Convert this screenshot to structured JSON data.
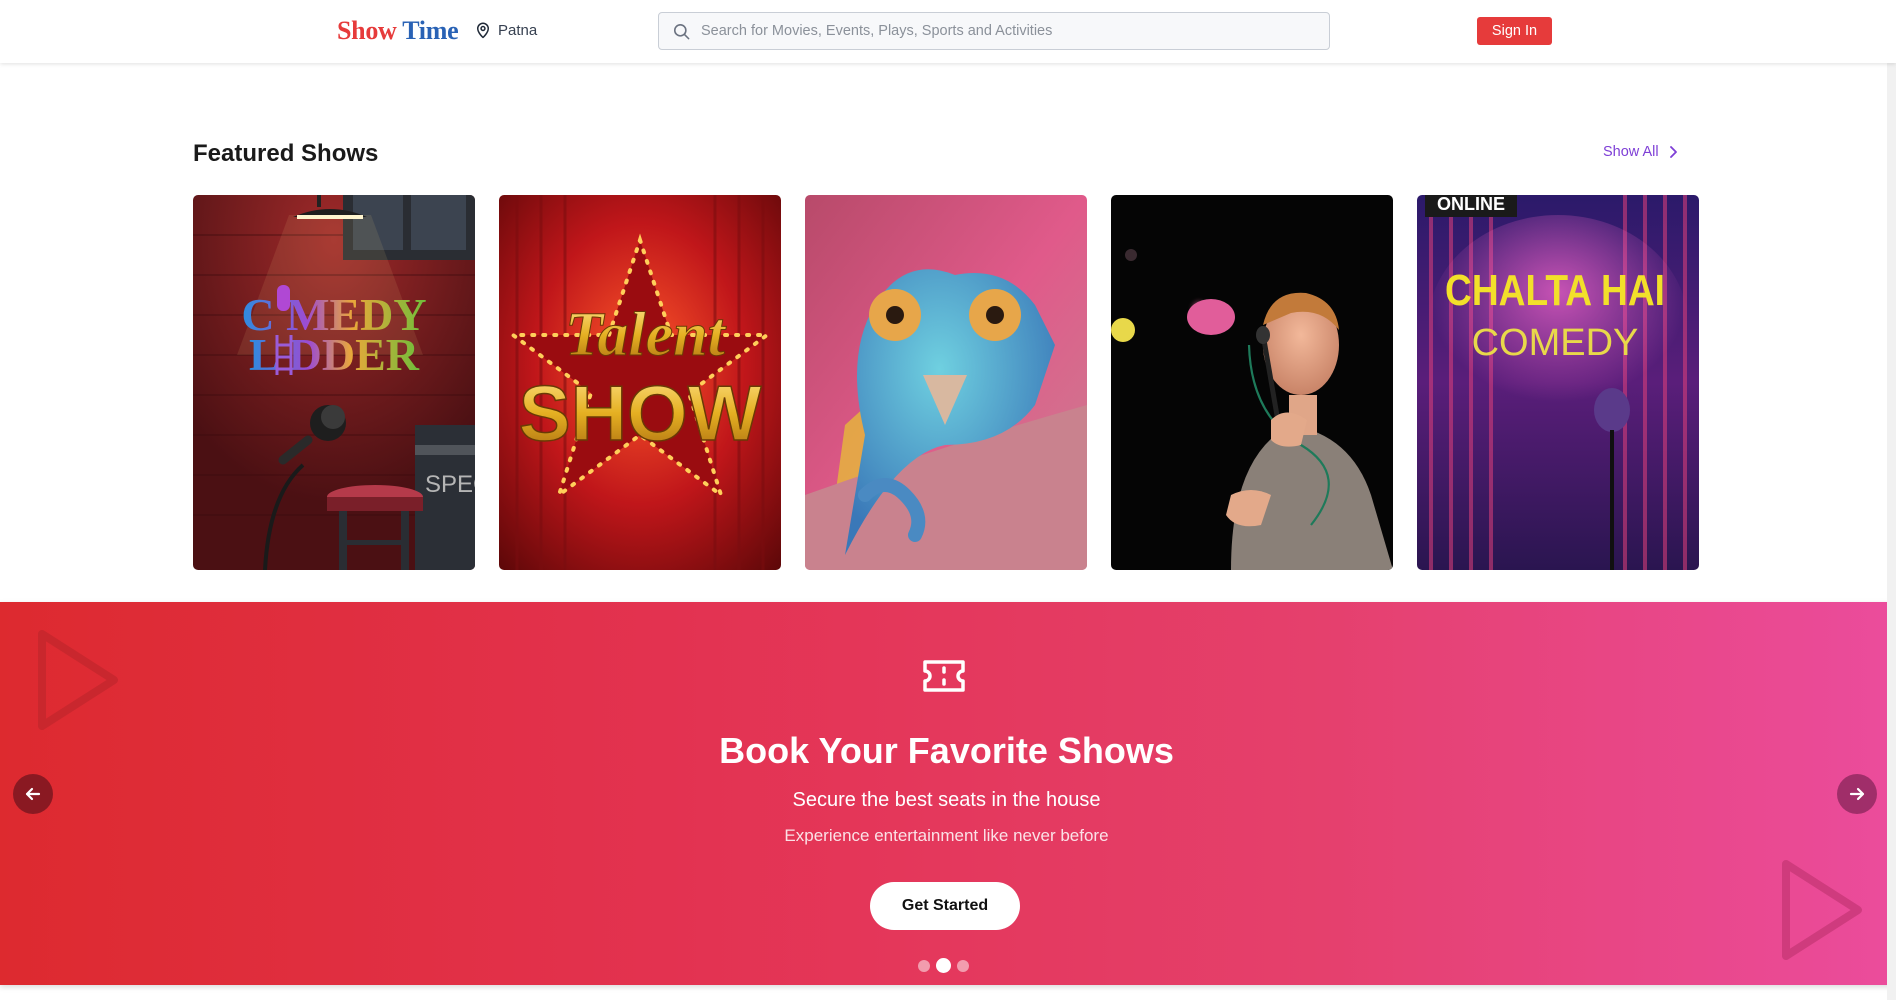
{
  "header": {
    "logo_word1": "Show",
    "logo_word2": "Time",
    "location": "Patna",
    "search_placeholder": "Search for Movies, Events, Plays, Sports and Activities",
    "signin_label": "Sign In"
  },
  "featured": {
    "title": "Featured Shows",
    "show_all_label": "Show All",
    "cards": [
      {
        "name": "comedy-ladder",
        "line1": "C MEDY",
        "line2": "L DDER",
        "sign": "SPECI GUES"
      },
      {
        "name": "talent-show",
        "line1": "Talent",
        "line2": "SHOW"
      },
      {
        "name": "chameleon"
      },
      {
        "name": "standup-performer"
      },
      {
        "name": "chalta-hai-comedy",
        "badge": "ONLINE",
        "line1": "CHALTA HAI",
        "line2": "COMEDY"
      }
    ]
  },
  "hero": {
    "title": "Book Your Favorite Shows",
    "subtitle": "Secure the best seats in the house",
    "tagline": "Experience entertainment like never before",
    "cta_label": "Get Started",
    "slides_total": 3,
    "active_slide": 2
  },
  "colors": {
    "brand_red": "#e63b3b",
    "brand_blue": "#2962b5",
    "link_purple": "#7e3fd6"
  }
}
